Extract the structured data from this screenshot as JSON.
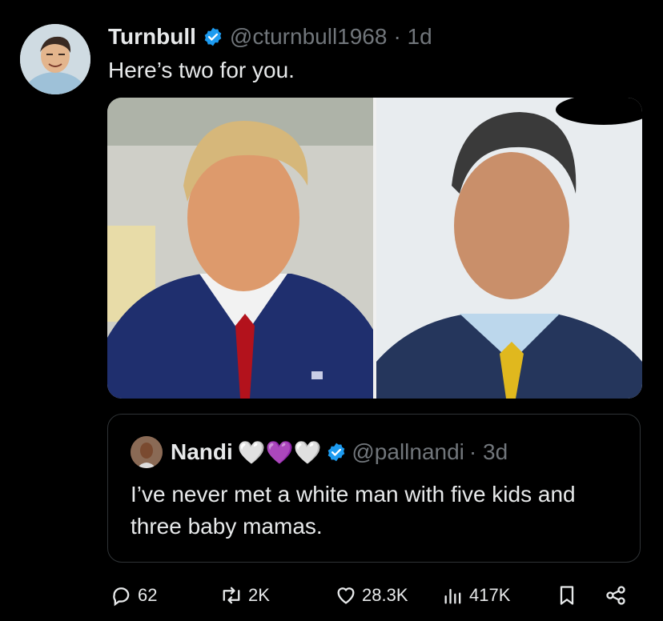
{
  "tweet": {
    "display_name": "Turnbull",
    "handle": "@cturnbull1968",
    "time": "· 1d",
    "text": "Here’s two for you."
  },
  "quoted": {
    "display_name": "Nandi",
    "emojis": "🤍💜🤍",
    "handle": "@pallnandi",
    "time": "· 3d",
    "text": "I’ve never met a white man with five kids and three baby mamas."
  },
  "actions": {
    "replies": "62",
    "reposts": "2K",
    "likes": "28.3K",
    "views": "417K"
  },
  "colors": {
    "background": "#000000",
    "text": "#e7e9ea",
    "muted": "#71767b",
    "verified": "#1d9bf0",
    "border": "#2f3336"
  },
  "icons": [
    "verified-badge-icon",
    "reply-icon",
    "repost-icon",
    "like-icon",
    "views-icon",
    "bookmark-icon",
    "share-icon"
  ]
}
